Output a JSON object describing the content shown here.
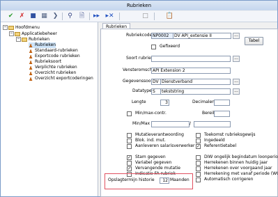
{
  "window": {
    "title": "Rubrieken"
  },
  "toolbar": {
    "icons": [
      "check-icon",
      "cancel-icon",
      "save-icon",
      "grid-icon",
      "chevron-icon",
      "search-icon",
      "doc-search-icon",
      "next-icon",
      "remove-next-icon",
      "blank-icon",
      "paste-icon"
    ]
  },
  "tree": {
    "items": [
      {
        "label": "Hoofdmenu",
        "toggle": "−"
      },
      {
        "label": "Applicatiebeheer",
        "toggle": "−"
      },
      {
        "label": "Rubrieken",
        "toggle": "−"
      },
      {
        "label": "Rubrieken"
      },
      {
        "label": "Standaard-rubrieken"
      },
      {
        "label": "Exportcode rubrieken"
      },
      {
        "label": "Rubrieksoort"
      },
      {
        "label": "Verplichte rubrieken"
      },
      {
        "label": "Overzicht rubrieken"
      },
      {
        "label": "Overzicht exportcoderingen"
      }
    ]
  },
  "tab": {
    "label": "Rubrieken"
  },
  "form": {
    "rubriekcode_label": "Rubriekcode",
    "rubriekcode_value": "NP0002",
    "rubriekcode_desc": "DV API_extensie II",
    "tabel_button": "Tabel",
    "gefixeerd": "Gefixeerd",
    "soort_rubriek_label": "Soort rubriek",
    "soort_rubriek_value": "",
    "vensteromschr_label": "Vensteromschr.",
    "vensteromschr_value": "API Extension 2",
    "gegevenssoort_label": "Gegevenssoort",
    "gegevenssoort_code": "DV",
    "gegevenssoort_desc": "Dienstverband",
    "datatype_label": "Datatype",
    "datatype_code": "S",
    "datatype_desc": "tekststring",
    "lengte_label": "Lengte",
    "lengte_value": "3",
    "decimalen_label": "Decimalen",
    "decimalen_value": "",
    "minmax_contr": "Min/max-contr.",
    "bereik_label": "Bereik",
    "minmax_label": "Min/Max",
    "minmax_sep": "/",
    "dots": "...",
    "checks": [
      {
        "label": "Mutatieverantwoording",
        "checked": false
      },
      {
        "label": "Blok. ind. mut.",
        "checked": false
      },
      {
        "label": "Aanleveren salarisverwerker",
        "checked": false
      },
      {
        "label": "Toekomst rubrieksgewijs",
        "checked": false
      },
      {
        "label": "Ingedeeld",
        "checked": false
      },
      {
        "label": "Referentietabel",
        "checked": true
      },
      {
        "label": "Stam gegeven",
        "checked": true
      },
      {
        "label": "Variabel gegeven",
        "checked": false
      },
      {
        "label": "Vervangende mutatie",
        "checked": true
      },
      {
        "label": "Indicatie FA rubriek",
        "checked": false
      },
      {
        "label": "DIW ongelijk begindatum loonperiode",
        "checked": false
      },
      {
        "label": "Herrekenen binnen huidig jaar",
        "checked": false
      },
      {
        "label": "Herrekenen over voorgaand jaar",
        "checked": false
      },
      {
        "label": "Herrekening met vanaf periode (WG)",
        "checked": false
      },
      {
        "label": "Automatisch corrigeren",
        "checked": false
      }
    ],
    "opslag_label": "Opslagtermijn historie",
    "opslag_value": "12",
    "opslag_unit": "Maanden"
  }
}
